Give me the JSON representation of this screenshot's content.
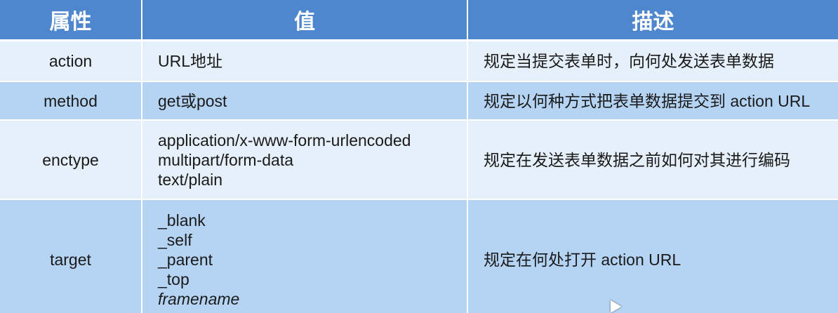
{
  "table": {
    "headers": [
      "属性",
      "值",
      "描述"
    ],
    "rows": [
      {
        "attribute": "action",
        "values": [
          "URL地址"
        ],
        "description": "规定当提交表单时，向何处发送表单数据"
      },
      {
        "attribute": "method",
        "values": [
          "get或post"
        ],
        "description": "规定以何种方式把表单数据提交到 action URL"
      },
      {
        "attribute": "enctype",
        "values": [
          "application/x-www-form-urlencoded",
          "multipart/form-data",
          "text/plain"
        ],
        "description": "规定在发送表单数据之前如何对其进行编码"
      },
      {
        "attribute": "target",
        "values": [
          "_blank",
          "_self",
          "_parent",
          "_top",
          "framename"
        ],
        "description": "规定在何处打开 action URL"
      }
    ]
  },
  "colors": {
    "header_bg": "#4f87cf",
    "row_light": "#e6f0fa",
    "row_dark": "#b5d4f4"
  },
  "icons": {
    "cursor": "mouse-pointer-icon"
  }
}
